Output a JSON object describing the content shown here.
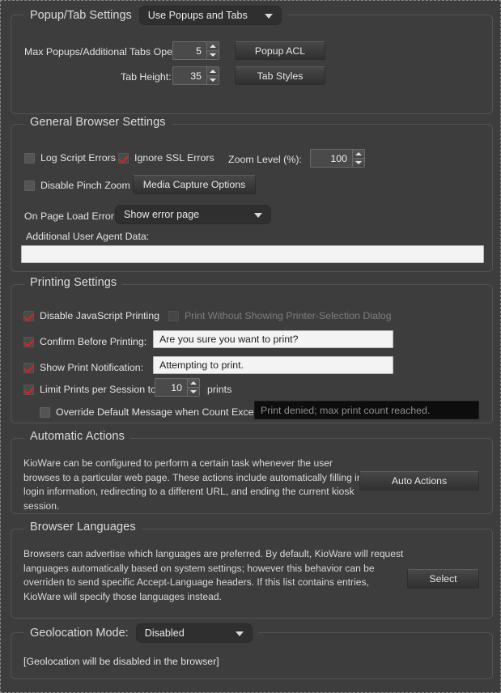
{
  "popup_tab": {
    "title": "Popup/Tab Settings",
    "mode_value": "Use Popups and Tabs",
    "max_popups_label": "Max Popups/Additional Tabs Open:",
    "max_popups_value": "5",
    "tab_height_label": "Tab Height:",
    "tab_height_value": "35",
    "popup_acl_button": "Popup ACL",
    "tab_styles_button": "Tab Styles"
  },
  "general": {
    "title": "General Browser Settings",
    "log_script_errors": "Log Script Errors",
    "ignore_ssl_errors": "Ignore SSL Errors",
    "zoom_level_label": "Zoom Level (%):",
    "zoom_level_value": "100",
    "disable_pinch_zoom": "Disable Pinch Zoom",
    "media_capture_button": "Media Capture Options",
    "page_load_error_label": "On Page Load Error:",
    "page_load_error_value": "Show error page",
    "user_agent_label": "Additional User Agent Data:",
    "user_agent_value": ""
  },
  "printing": {
    "title": "Printing Settings",
    "disable_js_printing": "Disable JavaScript Printing",
    "print_without_dialog": "Print Without Showing Printer-Selection Dialog",
    "confirm_before_printing": "Confirm Before Printing:",
    "confirm_before_printing_value": "Are you sure you want to print?",
    "show_print_notification": "Show Print Notification:",
    "show_print_notification_value": "Attempting to print.",
    "limit_prints_label": "Limit Prints per Session to",
    "limit_prints_value": "10",
    "limit_prints_suffix": "prints",
    "override_message_label": "Override Default Message when Count Exceeded:",
    "override_message_value": "Print denied; max print count reached."
  },
  "automatic_actions": {
    "title": "Automatic Actions",
    "description": "KioWare can be configured to perform a certain task whenever the user browses to a particular web page. These actions include automatically filling in login information, redirecting to a different URL, and ending the current kiosk session.",
    "button": "Auto Actions"
  },
  "browser_languages": {
    "title": "Browser Languages",
    "description": "Browsers can advertise which languages are preferred. By default, KioWare will request languages automatically based on system settings; however this behavior can be overriden to send specific Accept-Language headers. If this list contains entries, KioWare will specify those languages instead.",
    "button": "Select"
  },
  "geolocation": {
    "title": "Geolocation Mode:",
    "mode_value": "Disabled",
    "status_text": "[Geolocation will be disabled in the browser]"
  },
  "colors": {
    "background": "#3d3d3d",
    "check_red": "#e02020",
    "text": "#e2e2e2",
    "disabled_text": "#7d7d7d",
    "input_light": "#f3f3f3"
  }
}
